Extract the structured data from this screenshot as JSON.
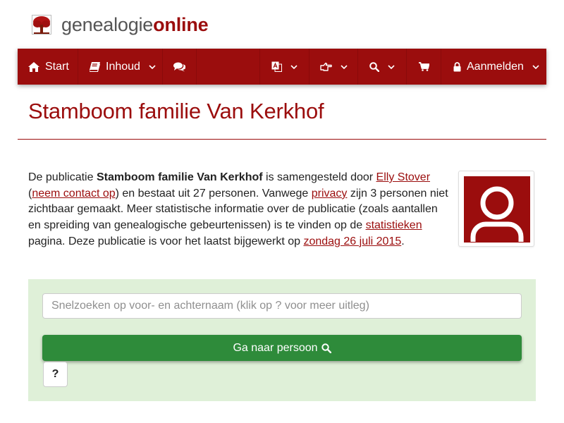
{
  "site": {
    "logo_part1": "genealogie",
    "logo_part2": "online"
  },
  "nav": {
    "start_label": "Start",
    "inhoud_label": "Inhoud",
    "login_label": "Aanmelden",
    "icons": [
      "home-icon",
      "book-icon",
      "comments-icon",
      "translate-icon",
      "hand-point-right-icon",
      "search-icon",
      "cart-icon",
      "lock-icon"
    ]
  },
  "page": {
    "title": "Stamboom familie Van Kerkhof"
  },
  "intro": {
    "t1": "De publicatie ",
    "pub_name": "Stamboom familie Van Kerkhof",
    "t2": " is samengesteld door ",
    "author": "Elly Stover",
    "t3": "\n(",
    "contact": "neem contact op",
    "t4": ") en bestaat uit 27 personen. Vanwege ",
    "privacy": "privacy",
    "t5": " zijn 3 personen niet zichtbaar gemaakt. Meer statistische informatie over de publicatie (zoals aantallen en spreiding van genealogische gebeurtenissen) is te vinden op de ",
    "stats": "statistieken",
    "t6": "\npagina. Deze publicatie is voor het laatst bijgewerkt op ",
    "date": "zondag 26 juli 2015",
    "t7": "."
  },
  "search": {
    "placeholder": "Snelzoeken op voor- en achternaam (klik op ? voor meer uitleg)",
    "value": "",
    "button_label": "Ga naar persoon",
    "help_label": "?"
  },
  "colors": {
    "brand": "#9b0d0d",
    "panel_bg": "#dff0d8",
    "button_green": "#2e8b3a"
  }
}
